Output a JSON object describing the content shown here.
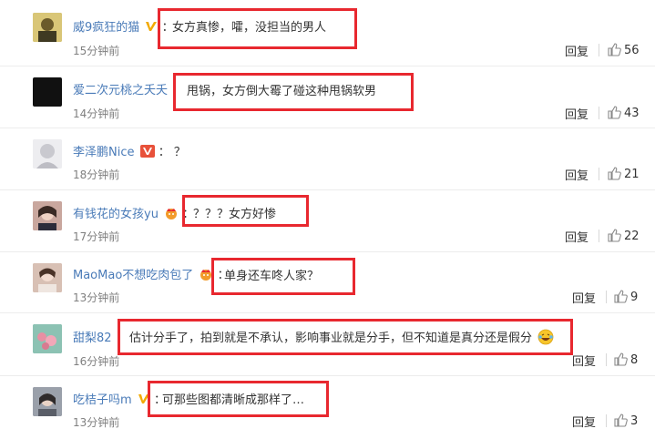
{
  "comments": [
    {
      "name": "威9疯狂的猫",
      "badge": "gold-v",
      "text": "女方真惨，嚯，没担当的男人",
      "time": "15分钟前",
      "reply": "回复",
      "likes": "56",
      "avatar_color": "#c8b56a"
    },
    {
      "name": "爱二次元桃之夭夭",
      "badge": "",
      "text": "甩锅，女方倒大霉了碰这种甩锅软男",
      "time": "14分钟前",
      "reply": "回复",
      "likes": "43",
      "avatar_color": "#111111"
    },
    {
      "name": "李泽鹏Nice",
      "badge": "red-v",
      "text": "？",
      "time": "18分钟前",
      "reply": "回复",
      "likes": "21",
      "avatar_color": "#d9d9de"
    },
    {
      "name": "有钱花的女孩yu",
      "badge": "crown",
      "text": "？？？女方好惨",
      "time": "17分钟前",
      "reply": "回复",
      "likes": "22",
      "avatar_color": "#b08e86"
    },
    {
      "name": "MaoMao不想吃肉包了",
      "badge": "crown",
      "text": "单身还车咚人家？",
      "time": "13分钟前",
      "reply": "回复",
      "likes": "9",
      "avatar_color": "#c7a99a"
    },
    {
      "name": "甜梨82",
      "badge": "",
      "text": "估计分手了，拍到就是不承认，影响事业就是分手，但不知道是真分还是假分",
      "time": "16分钟前",
      "reply": "回复",
      "likes": "8",
      "avatar_color": "#7fb7a8"
    },
    {
      "name": "吃桔子吗m",
      "badge": "gold-v",
      "text": "可那些图都清晰成那样了…",
      "time": "13分钟前",
      "reply": "回复",
      "likes": "3",
      "avatar_color": "#8a8f9a"
    }
  ],
  "colors": {
    "name": "#4a7bb8",
    "highlight": "#e8282f",
    "time": "#808080"
  }
}
